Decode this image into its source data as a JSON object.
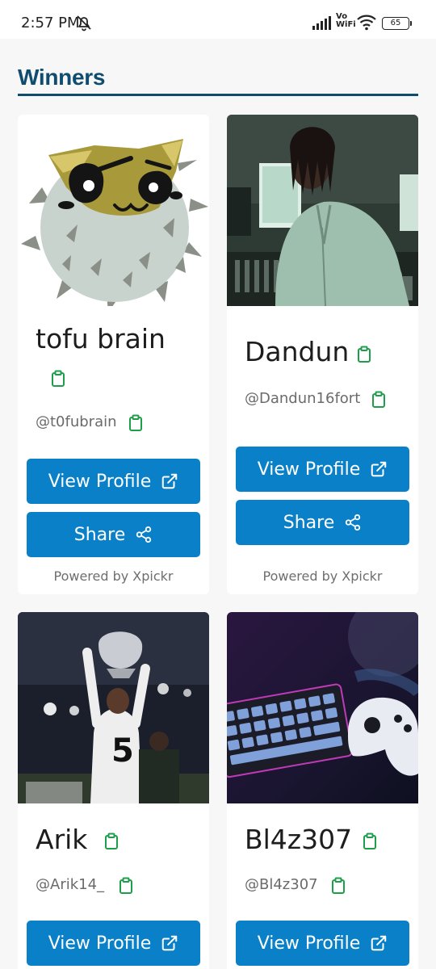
{
  "status_bar": {
    "time": "2:57 PM",
    "vowifi": [
      "Vo",
      "WiFi"
    ],
    "battery": "65"
  },
  "page": {
    "title": "Winners"
  },
  "cards": [
    {
      "name": "tofu brain",
      "handle": "@t0fubrain",
      "view_label": "View Profile",
      "share_label": "Share",
      "powered": "Powered by Xpickr",
      "photo": "pufferfish-illustration"
    },
    {
      "name": "Dandun",
      "handle": "@Dandun16fort",
      "view_label": "View Profile",
      "share_label": "Share",
      "powered": "Powered by Xpickr",
      "photo": "man-in-studio"
    },
    {
      "name": "Arik",
      "handle": "@Arik14_",
      "view_label": "View Profile",
      "photo": "football-trophy"
    },
    {
      "name": "Bl4z307",
      "handle": "@Bl4z307",
      "view_label": "View Profile",
      "photo": "keyboard-and-controller"
    }
  ],
  "colors": {
    "title": "#0f4c6e",
    "button": "#0a80c8",
    "clipboard_icon": "#1e9e4a"
  },
  "icons": [
    "mute-icon",
    "signal-icon",
    "wifi-icon",
    "clipboard-icon",
    "external-link-icon",
    "share-icon"
  ]
}
